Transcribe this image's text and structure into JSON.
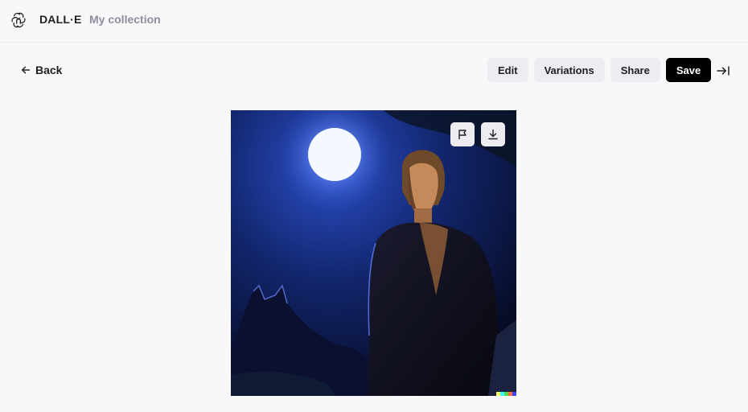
{
  "header": {
    "brand": "DALL·E",
    "nav_link": "My collection"
  },
  "toolbar": {
    "back_label": "Back",
    "edit_label": "Edit",
    "variations_label": "Variations",
    "share_label": "Share",
    "save_label": "Save"
  },
  "icons": {
    "logo": "openai-logo-icon",
    "back": "arrow-left-icon",
    "collapse": "arrow-right-to-line-icon",
    "flag": "flag-icon",
    "download": "download-icon"
  },
  "colors": {
    "background": "#f8f8fa",
    "button_bg": "#ececf1",
    "primary_button_bg": "#000000",
    "muted_text": "#8e8ea0",
    "signature": [
      "#ffff66",
      "#42ffff",
      "#51da4c",
      "#ff6e3c",
      "#3c46ff"
    ]
  }
}
